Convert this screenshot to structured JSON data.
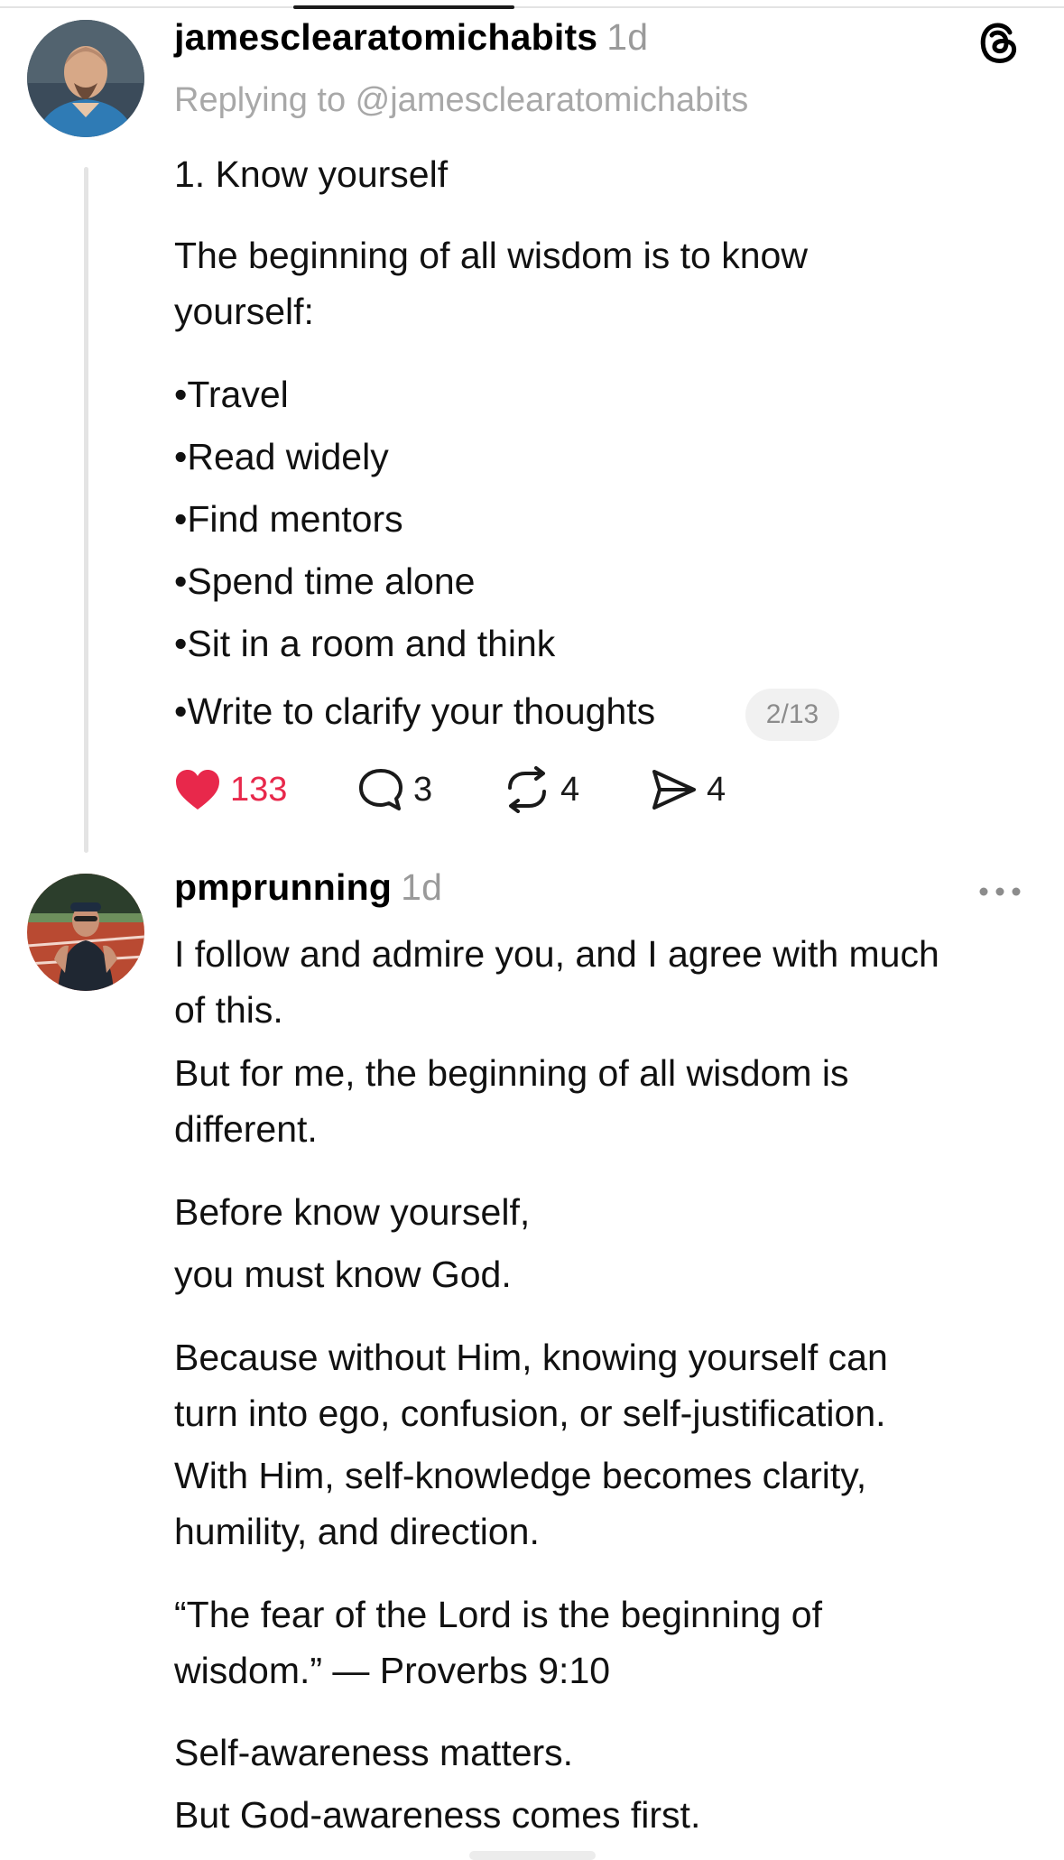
{
  "post": {
    "username": "jamesclearatomichabits",
    "time": "1d",
    "replying_to": "Replying to @jamesclearatomichabits",
    "heading": "1. Know yourself",
    "intro": [
      "The beginning of all wisdom is to know",
      "yourself:"
    ],
    "bullets": [
      "•Travel",
      "•Read widely",
      "•Find mentors",
      "•Spend time alone",
      "•Sit in a room and think",
      "•Write to clarify your thoughts"
    ],
    "thread_counter": "2/13",
    "actions": {
      "likes": "133",
      "replies": "3",
      "reposts": "4",
      "shares": "4"
    }
  },
  "reply": {
    "username": "pmprunning",
    "time": "1d",
    "lines": [
      "I follow and admire you, and I agree with much",
      "of this.",
      "But for me, the beginning of all wisdom is",
      "different.",
      "Before know yourself,",
      "you must know God.",
      "Because without Him, knowing yourself can",
      "turn into ego, confusion, or self-justification.",
      "With Him, self-knowledge becomes clarity,",
      "humility, and direction.",
      "“The fear of the Lord is the beginning of",
      "wisdom.” — Proverbs 9:10",
      "Self-awareness matters.",
      "But God-awareness comes first."
    ]
  },
  "colors": {
    "like": "#e8284b",
    "muted": "#9a9a9a",
    "thread_line": "#e4e4e4"
  },
  "icons": [
    "threads-logo-icon",
    "heart-icon",
    "comment-icon",
    "repost-icon",
    "share-icon",
    "more-options-icon"
  ]
}
